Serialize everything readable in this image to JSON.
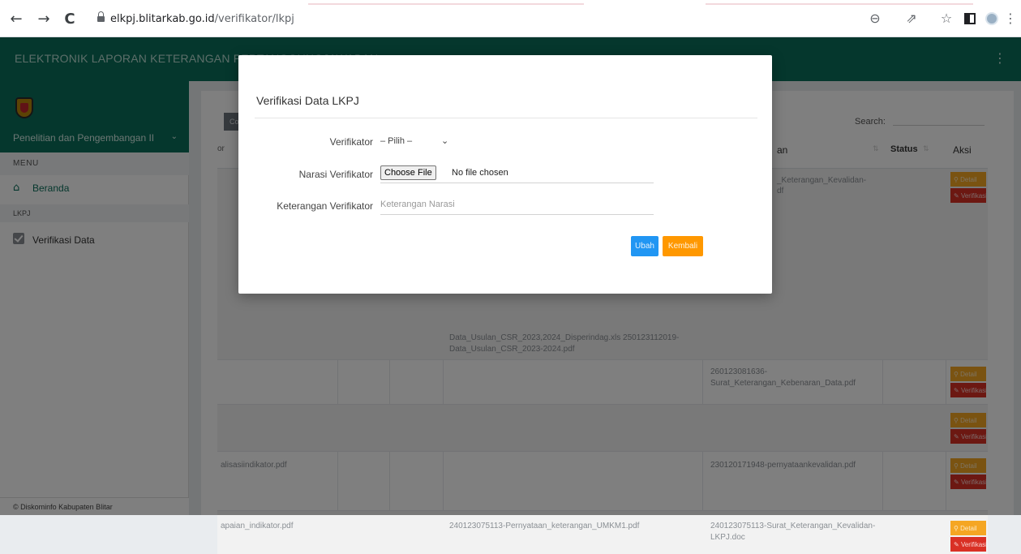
{
  "browser": {
    "back_icon": "←",
    "forward_icon": "→",
    "reload_icon": "C",
    "url_domain": "elkpj.blitarkab.go.id",
    "url_path": "/verifikator/lkpj",
    "zoom_icon": "⊖",
    "share_icon": "⇗",
    "star_icon": "☆",
    "menu_icon": "⋮"
  },
  "header": {
    "title": "ELEKTRONIK LAPORAN KETERANGAN PERTANGGUNGJAWABAN",
    "menu_icon": "⋮"
  },
  "sidebar": {
    "department": "Penelitian dan Pengembangan II",
    "menu_head": "MENU",
    "home_label": "Beranda",
    "section": "LKPJ",
    "verif_label": "Verifikasi Data",
    "footer": "© Diskominfo Kabupaten Blitar"
  },
  "toolbar": {
    "copy_label": "Copy",
    "search_label": "Search:"
  },
  "table": {
    "col_first_partial": "or",
    "col_keterangan_partial": "an",
    "col_status": "Status",
    "col_aksi": "Aksi",
    "row1_ket": "_Keterangan_Kevalidan-",
    "row1_ket2": "df",
    "row1_usulan": "Data_Usulan_CSR_2023,2024_Disperindag.xls 250123112019-",
    "row1_usulan2": "Data_Usulan_CSR_2023-2024.pdf",
    "row2_ket": "260123081636-",
    "row2_ket2": "Surat_Keterangan_Kebenaran_Data.pdf",
    "row4_first": "alisasiindikator.pdf",
    "row4_ket": "230120171948-pernyataankevalidan.pdf",
    "row5_first": "apaian_indikator.pdf",
    "row5_mid": "240123075113-Pernyataan_keterangan_UMKM1.pdf",
    "row5_ket": "240123075113-Surat_Keterangan_Kevalidan-",
    "row5_ket2": "LKPJ.doc",
    "detail_label": "Detail",
    "verif_label": "Verifikasi"
  },
  "modal": {
    "title": "Verifikasi Data LKPJ",
    "verifikator_label": "Verifikator",
    "verifikator_value": "– Pilih –",
    "narasi_label": "Narasi Verifikator",
    "file_button": "Choose File",
    "file_status": "No file chosen",
    "keterangan_label": "Keterangan Verifikator",
    "keterangan_placeholder": "Keterangan Narasi",
    "ubah_label": "Ubah",
    "kembali_label": "Kembali"
  },
  "colors": {
    "header_green": "#0b6f5a",
    "primary_blue": "#2196f3",
    "warning_orange": "#ff9800",
    "danger_red": "#d93025"
  }
}
